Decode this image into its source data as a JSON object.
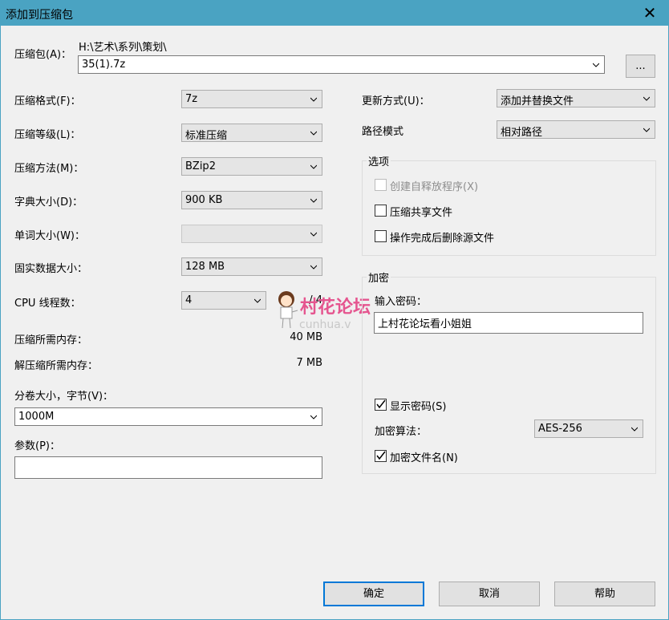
{
  "window": {
    "title": "添加到压缩包",
    "close_glyph": "✕"
  },
  "archive": {
    "label": "压缩包(A)：",
    "path_prefix": "H:\\艺术\\系列\\策划\\",
    "filename": "35(1).7z",
    "browse_label": "..."
  },
  "left": {
    "format_label": "压缩格式(F)：",
    "format_value": "7z",
    "level_label": "压缩等级(L)：",
    "level_value": "标准压缩",
    "method_label": "压缩方法(M)：",
    "method_value": "BZip2",
    "dict_label": "字典大小(D)：",
    "dict_value": "900 KB",
    "word_label": "单词大小(W)：",
    "word_value": "",
    "solid_label": "固实数据大小：",
    "solid_value": "128 MB",
    "cpu_label": "CPU 线程数：",
    "cpu_value": "4",
    "cpu_max": "/ 4",
    "mem_compress_label": "压缩所需内存：",
    "mem_compress_value": "40 MB",
    "mem_decompress_label": "解压缩所需内存：",
    "mem_decompress_value": "7 MB",
    "volume_label": "分卷大小，字节(V)：",
    "volume_value": "1000M",
    "params_label": "参数(P)：",
    "params_value": ""
  },
  "right": {
    "update_label": "更新方式(U)：",
    "update_value": "添加并替换文件",
    "path_mode_label": "路径模式",
    "path_mode_value": "相对路径",
    "options": {
      "title": "选项",
      "sfx_label": "创建自释放程序(X)",
      "sfx_checked": false,
      "sfx_disabled": true,
      "shared_label": "压缩共享文件",
      "shared_checked": false,
      "delete_label": "操作完成后删除源文件",
      "delete_checked": false
    },
    "encryption": {
      "title": "加密",
      "password_label": "输入密码：",
      "password_value": "上村花论坛看小姐姐",
      "show_password_label": "显示密码(S)",
      "show_password_checked": true,
      "algorithm_label": "加密算法：",
      "algorithm_value": "AES-256",
      "encrypt_names_label": "加密文件名(N)",
      "encrypt_names_checked": true
    }
  },
  "watermark": {
    "text": "村花论坛",
    "sub": "cunhua.v"
  },
  "buttons": {
    "ok": "确定",
    "cancel": "取消",
    "help": "帮助"
  },
  "colors": {
    "titlebar": "#4aa3c2",
    "accent": "#0078d7",
    "watermark": "#e5558f"
  }
}
